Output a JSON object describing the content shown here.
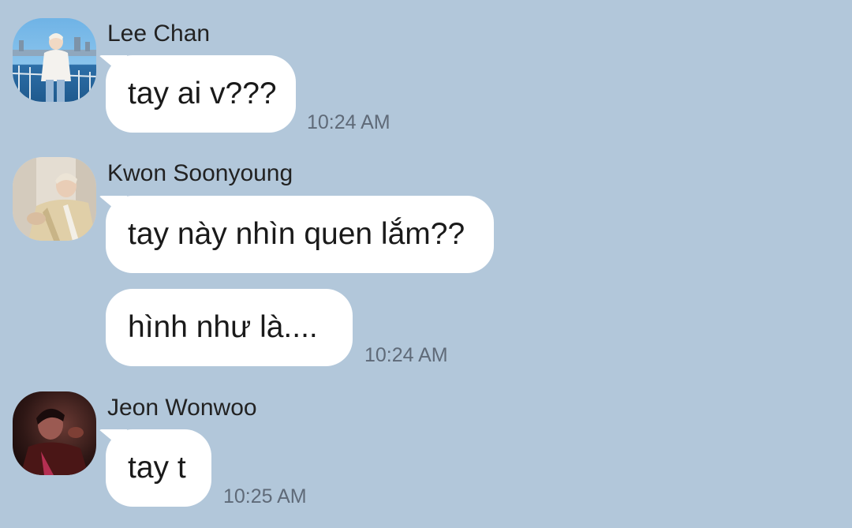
{
  "chat": {
    "background_color": "#b2c7da",
    "messages": [
      {
        "sender": "Lee Chan",
        "avatar_icon": "user-avatar-photo",
        "bubbles": [
          "tay ai v???"
        ],
        "time": "10:24 AM"
      },
      {
        "sender": "Kwon Soonyoung",
        "avatar_icon": "user-avatar-photo",
        "bubbles": [
          "tay này nhìn quen lắm??",
          "hình như là...."
        ],
        "time": "10:24 AM"
      },
      {
        "sender": "Jeon Wonwoo",
        "avatar_icon": "user-avatar-photo",
        "bubbles": [
          "tay t"
        ],
        "time": "10:25 AM"
      }
    ]
  }
}
